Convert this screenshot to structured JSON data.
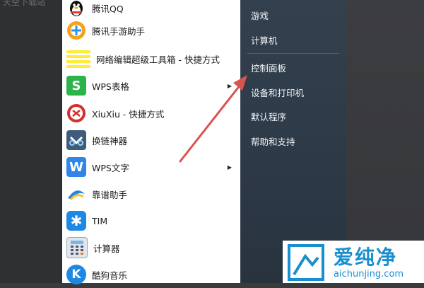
{
  "desktop": {
    "partial_text": "天空下载站"
  },
  "start_menu": {
    "programs": [
      {
        "label": "腾讯QQ",
        "icon": "qq-penguin-icon",
        "has_submenu": false
      },
      {
        "label": "腾讯手游助手",
        "icon": "tencent-game-assistant-icon",
        "has_submenu": false
      },
      {
        "label": "网络编辑超级工具箱 - 快捷方式",
        "icon": "toolbox-icon",
        "has_submenu": false
      },
      {
        "label": "WPS表格",
        "icon": "wps-spreadsheet-icon",
        "has_submenu": true
      },
      {
        "label": "XiuXiu - 快捷方式",
        "icon": "xiuxiu-icon",
        "has_submenu": false
      },
      {
        "label": "换链神器",
        "icon": "link-tool-icon",
        "has_submenu": false
      },
      {
        "label": "WPS文字",
        "icon": "wps-writer-icon",
        "has_submenu": true
      },
      {
        "label": "靠谱助手",
        "icon": "kaopu-assistant-icon",
        "has_submenu": false
      },
      {
        "label": "TIM",
        "icon": "tim-icon",
        "has_submenu": false
      },
      {
        "label": "计算器",
        "icon": "calculator-icon",
        "has_submenu": false
      },
      {
        "label": "酷狗音乐",
        "icon": "kugou-music-icon",
        "has_submenu": false
      }
    ],
    "right_pane": [
      {
        "label": "游戏"
      },
      {
        "label": "计算机"
      },
      {
        "label": "控制面板"
      },
      {
        "label": "设备和打印机"
      },
      {
        "label": "默认程序"
      },
      {
        "label": "帮助和支持"
      }
    ],
    "submenu_arrow": "▶"
  },
  "annotation": {
    "color": "#d9534f",
    "points_to": "控制面板"
  },
  "watermark": {
    "title": "爱纯净",
    "url": "aichunjing.com",
    "color": "#1a8fd0"
  }
}
